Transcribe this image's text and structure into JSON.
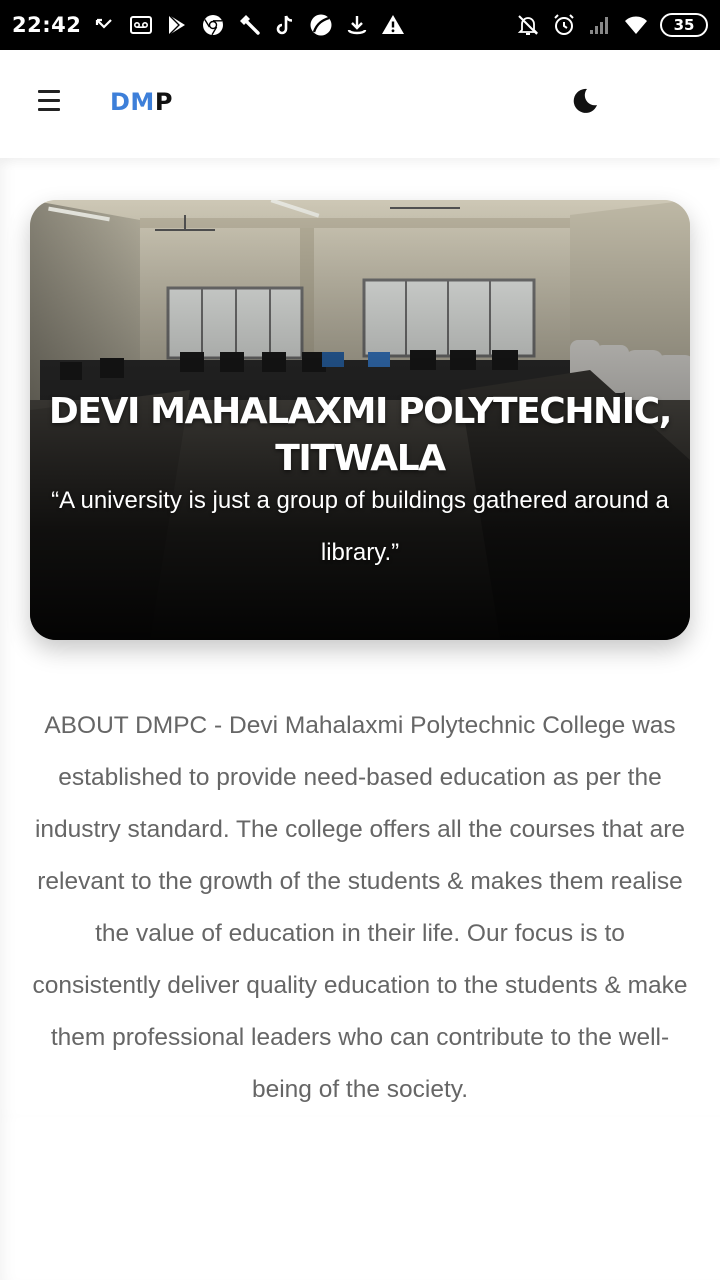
{
  "status_bar": {
    "time": "22:42",
    "battery": "35",
    "icons_left": [
      "missed-call-icon",
      "voicemail-icon",
      "play-store-icon",
      "chrome-icon",
      "hammer-icon",
      "tiktok-icon",
      "browser-icon",
      "download-icon",
      "warning-icon"
    ],
    "icons_right": [
      "bell-off-icon",
      "alarm-icon",
      "signal-icon",
      "wifi-icon",
      "battery-icon"
    ]
  },
  "header": {
    "logo_part1": "DM",
    "logo_part2": "P",
    "menu_icon": "hamburger-menu-icon",
    "theme_icon": "moon-icon",
    "logo_color": "#3d7fd9"
  },
  "hero": {
    "title": "DEVI MAHALAXMI POLYTECHNIC, TITWALA",
    "quote": "“A university is just a group of buildings gathered around a library.”"
  },
  "about": {
    "text": "ABOUT DMPC - Devi Mahalaxmi Polytechnic College was established to provide need-based education as per the industry standard. The college offers all the courses that are relevant to the growth of the students & makes them realise the value of education in their life. Our focus is to consistently deliver quality education to the students & make them professional leaders who can contribute to the well-being of the society."
  }
}
